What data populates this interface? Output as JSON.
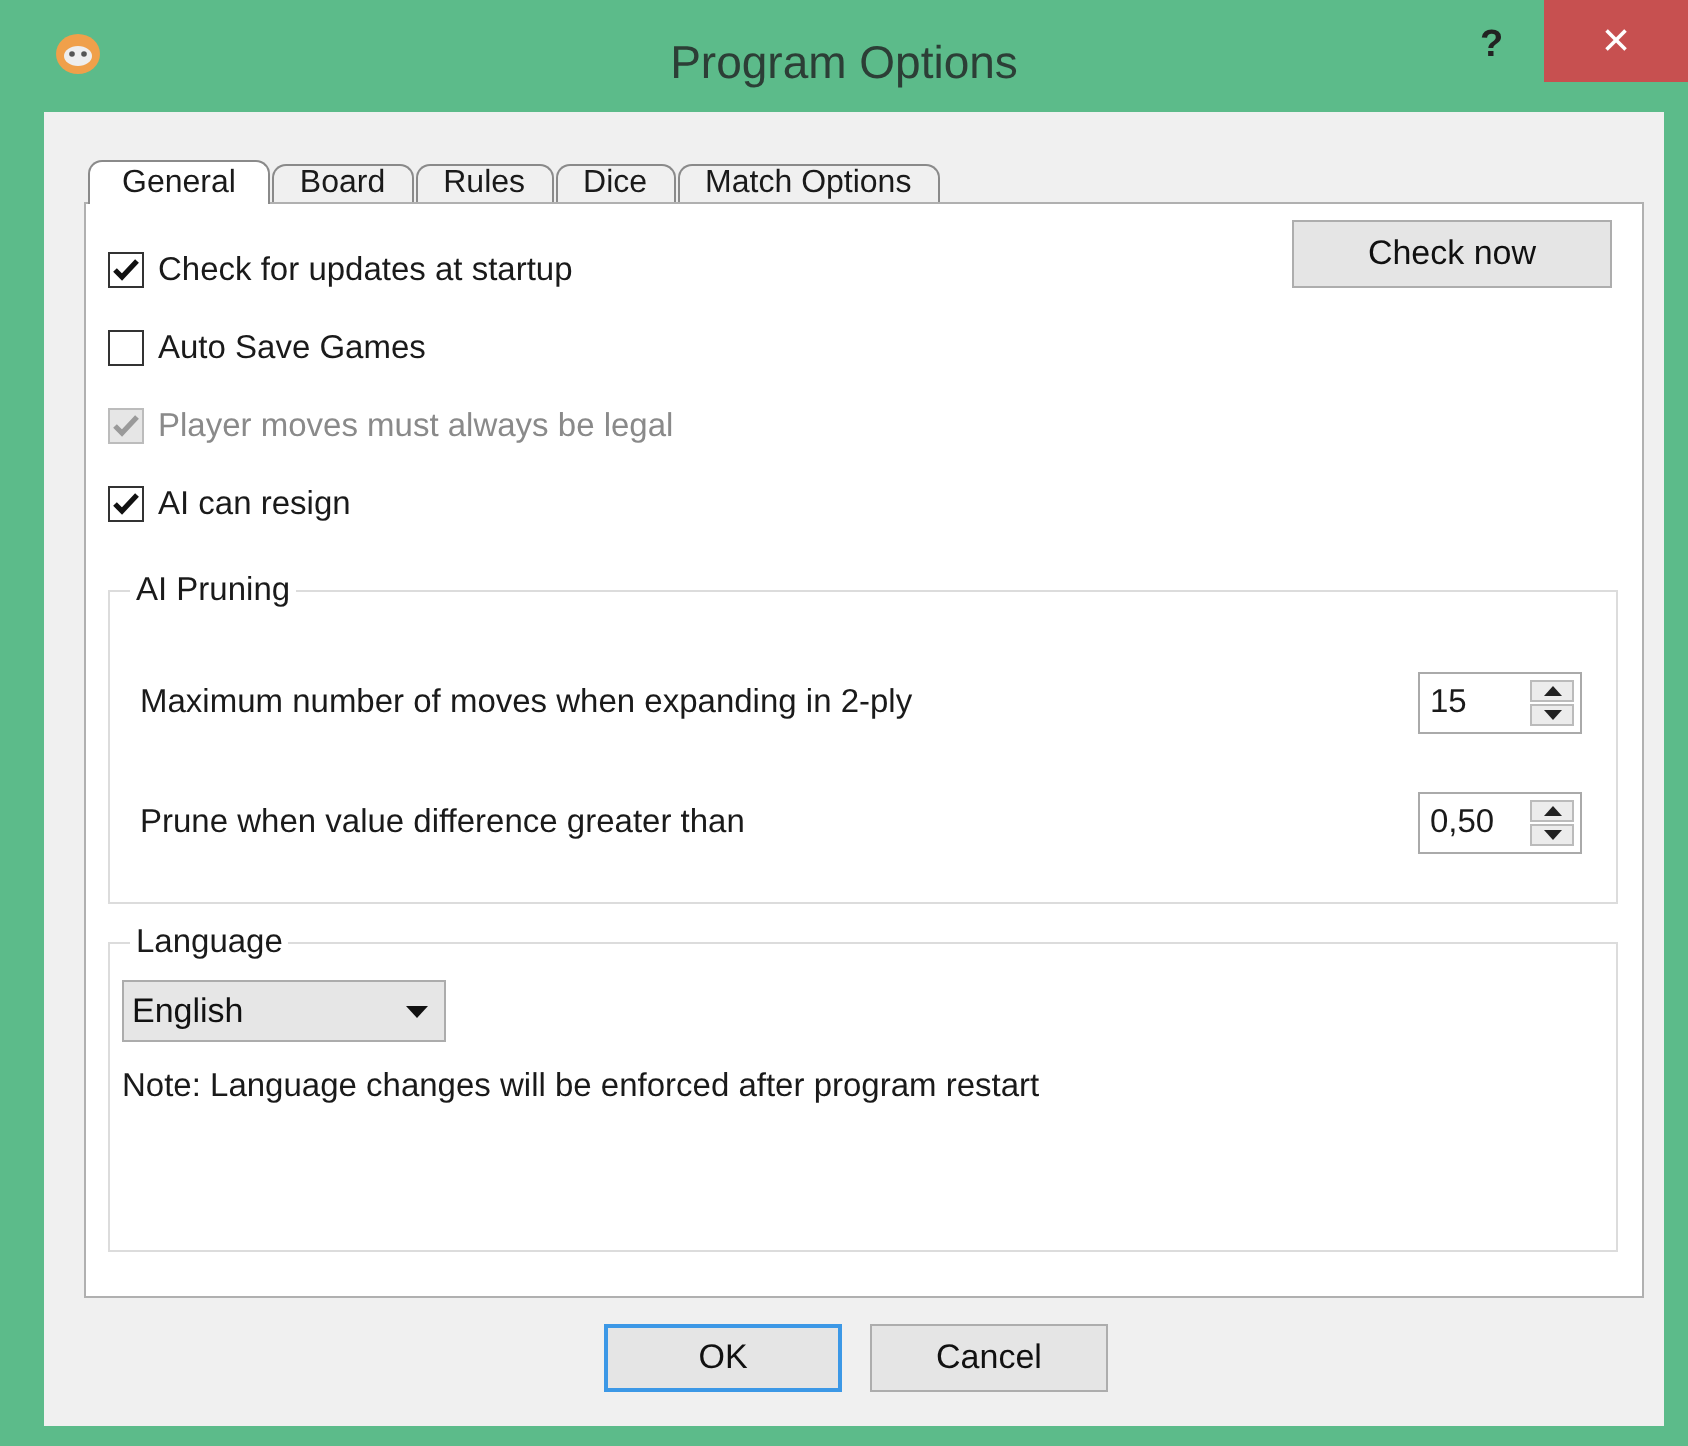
{
  "window": {
    "title": "Program Options",
    "help_button": "?",
    "close_button": "×"
  },
  "tabs": [
    {
      "label": "General",
      "selected": true
    },
    {
      "label": "Board",
      "selected": false
    },
    {
      "label": "Rules",
      "selected": false
    },
    {
      "label": "Dice",
      "selected": false
    },
    {
      "label": "Match Options",
      "selected": false
    }
  ],
  "options": [
    {
      "label": "Check for updates at startup",
      "checked": true,
      "disabled": false
    },
    {
      "label": "Auto Save Games",
      "checked": false,
      "disabled": false
    },
    {
      "label": "Player moves must always be legal",
      "checked": true,
      "disabled": true
    },
    {
      "label": "AI can resign",
      "checked": true,
      "disabled": false
    }
  ],
  "check_now_button": "Check now",
  "ai_pruning": {
    "title": "AI Pruning",
    "fields": [
      {
        "label": "Maximum number of moves when expanding in 2-ply",
        "value": "15"
      },
      {
        "label": "Prune when value difference greater than",
        "value": "0,50"
      }
    ]
  },
  "language": {
    "title": "Language",
    "value": "English",
    "note": "Note: Language changes will be enforced after program restart"
  },
  "buttons": [
    {
      "label": "OK",
      "default": true
    },
    {
      "label": "Cancel",
      "default": false
    }
  ]
}
